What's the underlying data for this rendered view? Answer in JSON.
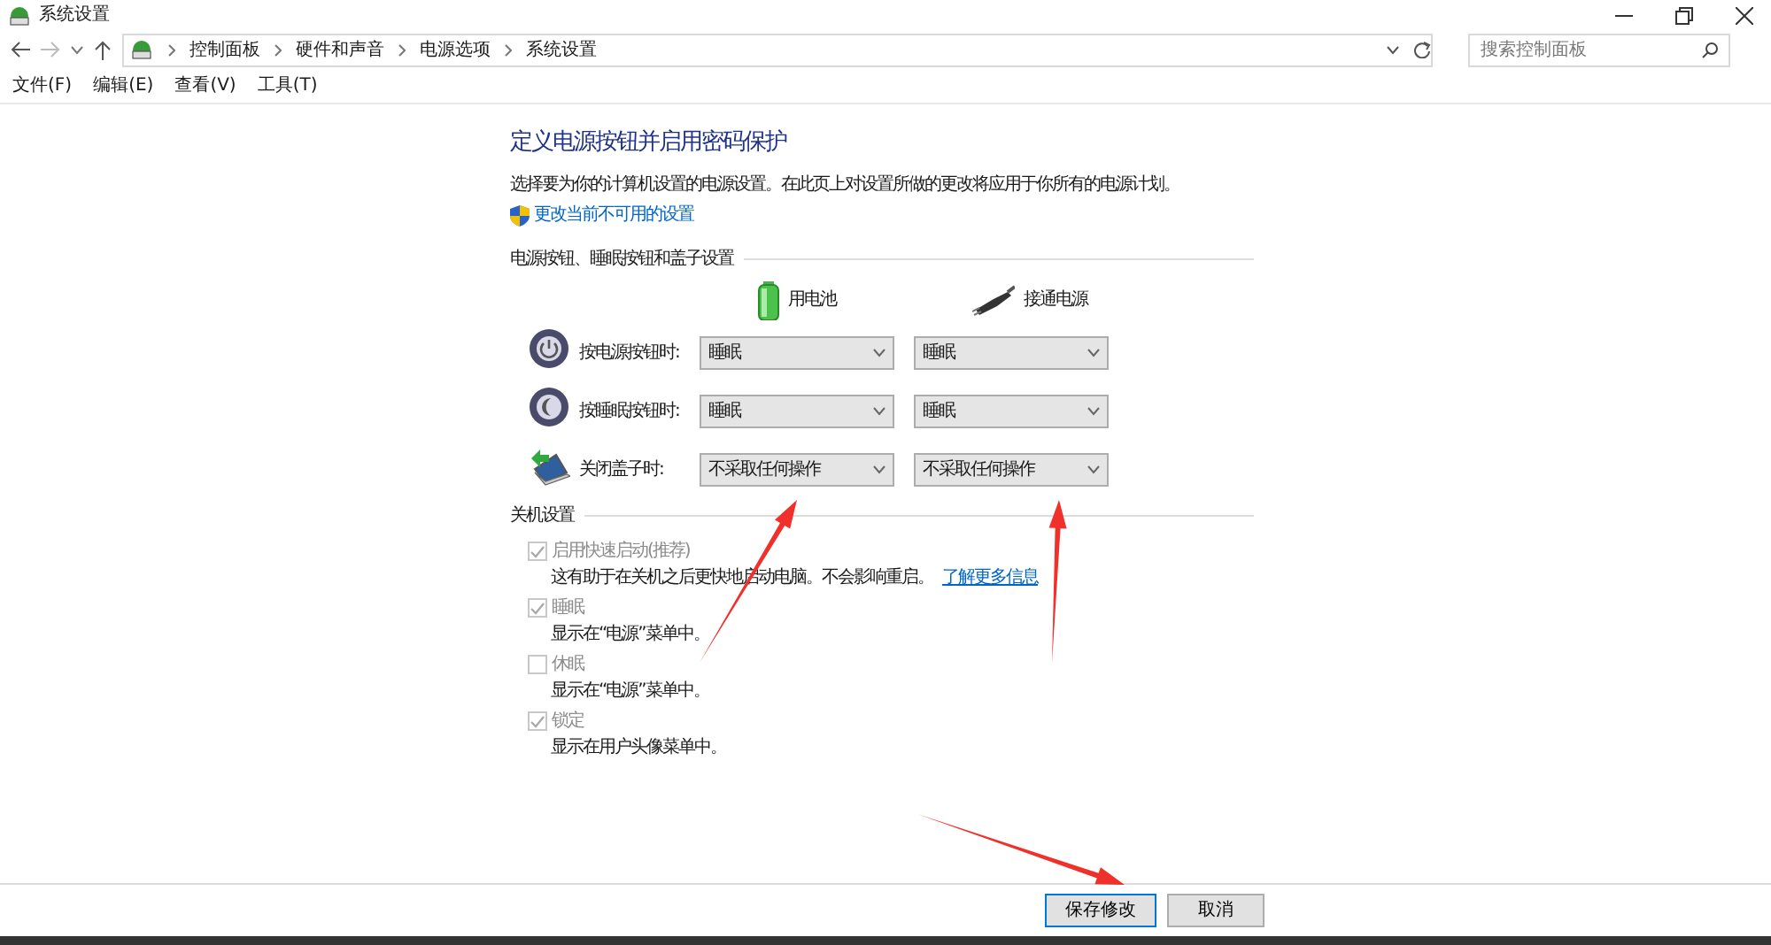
{
  "window": {
    "title": "系统设置"
  },
  "address_bar": {
    "breadcrumbs": [
      "控制面板",
      "硬件和声音",
      "电源选项",
      "系统设置"
    ]
  },
  "search": {
    "placeholder": "搜索控制面板"
  },
  "menu": [
    "文件(F)",
    "编辑(E)",
    "查看(V)",
    "工具(T)"
  ],
  "page": {
    "title": "定义电源按钮并启用密码保护",
    "description": "选择要为你的计算机设置的电源设置。在此页上对设置所做的更改将应用于你所有的电源计划。",
    "admin_link": "更改当前不可用的设置"
  },
  "power_section": {
    "heading": "电源按钮、睡眠按钮和盖子设置",
    "columns": [
      {
        "kind": "battery",
        "label": "用电池"
      },
      {
        "kind": "plug",
        "label": "接通电源"
      }
    ],
    "rows": [
      {
        "kind": "power",
        "label": "按电源按钮时:",
        "values": [
          {
            "value": "睡眠",
            "arrow": false
          },
          {
            "value": "睡眠",
            "arrow": false
          }
        ]
      },
      {
        "kind": "sleep",
        "label": "按睡眠按钮时:",
        "values": [
          {
            "value": "睡眠",
            "arrow": false
          },
          {
            "value": "睡眠",
            "arrow": false
          }
        ]
      },
      {
        "kind": "lid",
        "label": "关闭盖子时:",
        "values": [
          {
            "value": "不采取任何操作",
            "arrow": true
          },
          {
            "value": "不采取任何操作",
            "arrow": true
          }
        ]
      }
    ]
  },
  "shutdown_section": {
    "heading": "关机设置",
    "items": [
      {
        "label": "启用快速启动(推荐)",
        "checked": true,
        "disabled": true,
        "description": "这有助于在关机之后更快地启动电脑。不会影响重启。",
        "link": "了解更多信息"
      },
      {
        "label": "睡眠",
        "checked": true,
        "disabled": true,
        "description": "显示在“电源”菜单中。"
      },
      {
        "label": "休眠",
        "checked": false,
        "disabled": true,
        "description": "显示在“电源”菜单中。"
      },
      {
        "label": "锁定",
        "checked": true,
        "disabled": true,
        "description": "显示在用户头像菜单中。"
      }
    ]
  },
  "buttons": [
    {
      "label": "保存修改",
      "default": true,
      "arrow": true
    },
    {
      "label": "取消",
      "default": false,
      "arrow": false
    }
  ]
}
